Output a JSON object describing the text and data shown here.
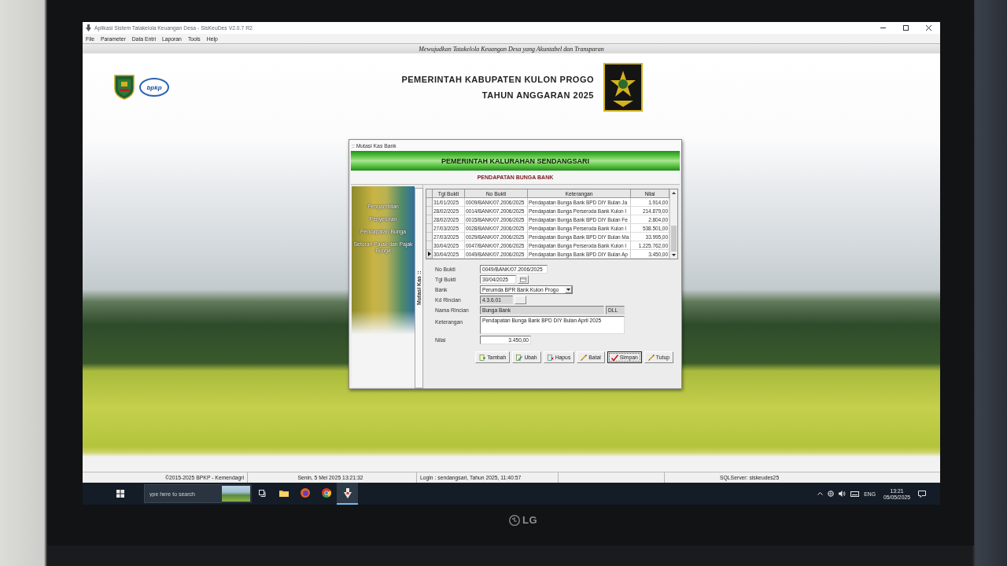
{
  "window": {
    "title": "Aplikasi Sistem Tatakelola Keuangan Desa - SisKeuDes V2.0.7 R2"
  },
  "menu": [
    "File",
    "Parameter",
    "Data Entri",
    "Laporan",
    "Tools",
    "Help"
  ],
  "banner": "Mewujudkan Tatakelola Keuangan Desa yang Akuntabel dan Transparan",
  "header": {
    "logo_text": "bpkp",
    "lines": [
      "PEMERINTAH KABUPATEN KULON PROGO",
      "TAHUN ANGGARAN 2025"
    ]
  },
  "dialog": {
    "title": ":: Mutasi Kas Bank",
    "heading": "PEMERINTAH KALURAHAN SENDANGSARI",
    "subheading": "PENDAPATAN BUNGA BANK",
    "side_menu": [
      "Pengambilan",
      "Penyetoran",
      "Pendapatan Bunga",
      "Setoran Pajak dan Pajak Bunga"
    ],
    "side_tab": "Mutasi Kas ::",
    "table": {
      "columns": [
        "Tgl Bukti",
        "No Bukti",
        "Keterangan",
        "Nilai"
      ],
      "rows": [
        {
          "cells": [
            "31/01/2025",
            "0009/BANK/07.2006/2025",
            "Pendapatan Bunga Bank BPD DIY Bulan Ja",
            "1.914,00"
          ],
          "selected": false
        },
        {
          "cells": [
            "28/02/2025",
            "0014/BANK/07.2006/2025",
            "Pendapatan Bunga Perseroda Bank Kulon I",
            "214.879,00"
          ],
          "selected": false
        },
        {
          "cells": [
            "28/02/2025",
            "0015/BANK/07.2006/2025",
            "Pendapatan Bunga Bank BPD DIY Bulan Fe",
            "2.804,00"
          ],
          "selected": false
        },
        {
          "cells": [
            "27/03/2025",
            "0028/BANK/07.2006/2025",
            "Pendapatan Bunga Perseroda Bank Kulon I",
            "538.501,00"
          ],
          "selected": false
        },
        {
          "cells": [
            "27/03/2025",
            "0029/BANK/07.2006/2025",
            "Pendapatan Bunga Bank BPD DIY Bulan Ma",
            "33.995,00"
          ],
          "selected": false
        },
        {
          "cells": [
            "30/04/2025",
            "0047/BANK/07.2006/2025",
            "Pendapatan Bunga Perseroda Bank Kulon I",
            "1.225.762,00"
          ],
          "selected": false
        },
        {
          "cells": [
            "30/04/2025",
            "0049/BANK/07.2006/2025",
            "Pendapatan Bunga Bank BPD DIY Bulan Ap",
            "3.450,00"
          ],
          "selected": true
        }
      ]
    },
    "form": {
      "fields": [
        {
          "label": "No Bukti",
          "kind": "text",
          "value": "0049/BANK/07.2006/2025",
          "disabled": false
        },
        {
          "label": "Tgl Bukti",
          "kind": "date",
          "value": "30/04/2025",
          "disabled": false
        },
        {
          "label": "Bank",
          "kind": "select",
          "value": "Perumda BPR Bank Kulon Progo",
          "disabled": false
        },
        {
          "label": "Kd Rincian",
          "kind": "lookup",
          "value": "4.3.6.01",
          "disabled": true
        },
        {
          "label": "Nama Rincian",
          "kind": "pair",
          "value": "Bunga Bank",
          "extra": "DLL",
          "disabled": true
        },
        {
          "label": "Keterangan",
          "kind": "memo",
          "value": "Pendapatan Bunga Bank BPD DIY  Bulan April 2025",
          "disabled": false
        },
        {
          "label": "Nilai",
          "kind": "number",
          "value": "3.450,00",
          "disabled": false
        }
      ]
    },
    "buttons": [
      {
        "label": "Tambah",
        "focused": false
      },
      {
        "label": "Ubah",
        "focused": false
      },
      {
        "label": "Hapus",
        "focused": false
      },
      {
        "label": "Batal",
        "focused": false
      },
      {
        "label": "Simpan",
        "focused": true
      },
      {
        "label": "Tutup",
        "focused": false
      }
    ]
  },
  "status_bar": [
    "©2015-2025 BPKP - Kemendagri",
    "Senin, 5 Mei 2025  13:21:32",
    "Login : sendangsari,  Tahun 2025, 11:40:57",
    "SQLServer: siskeudes25"
  ],
  "taskbar": {
    "search": {
      "placeholder": "ype here to search"
    },
    "apps": [
      {
        "selected": false
      },
      {
        "selected": false
      },
      {
        "selected": false
      },
      {
        "selected": false
      },
      {
        "selected": true
      }
    ],
    "language": "ENG",
    "time": "13:21",
    "date": "05/05/2025"
  },
  "monitor": {
    "brand": "LG"
  }
}
